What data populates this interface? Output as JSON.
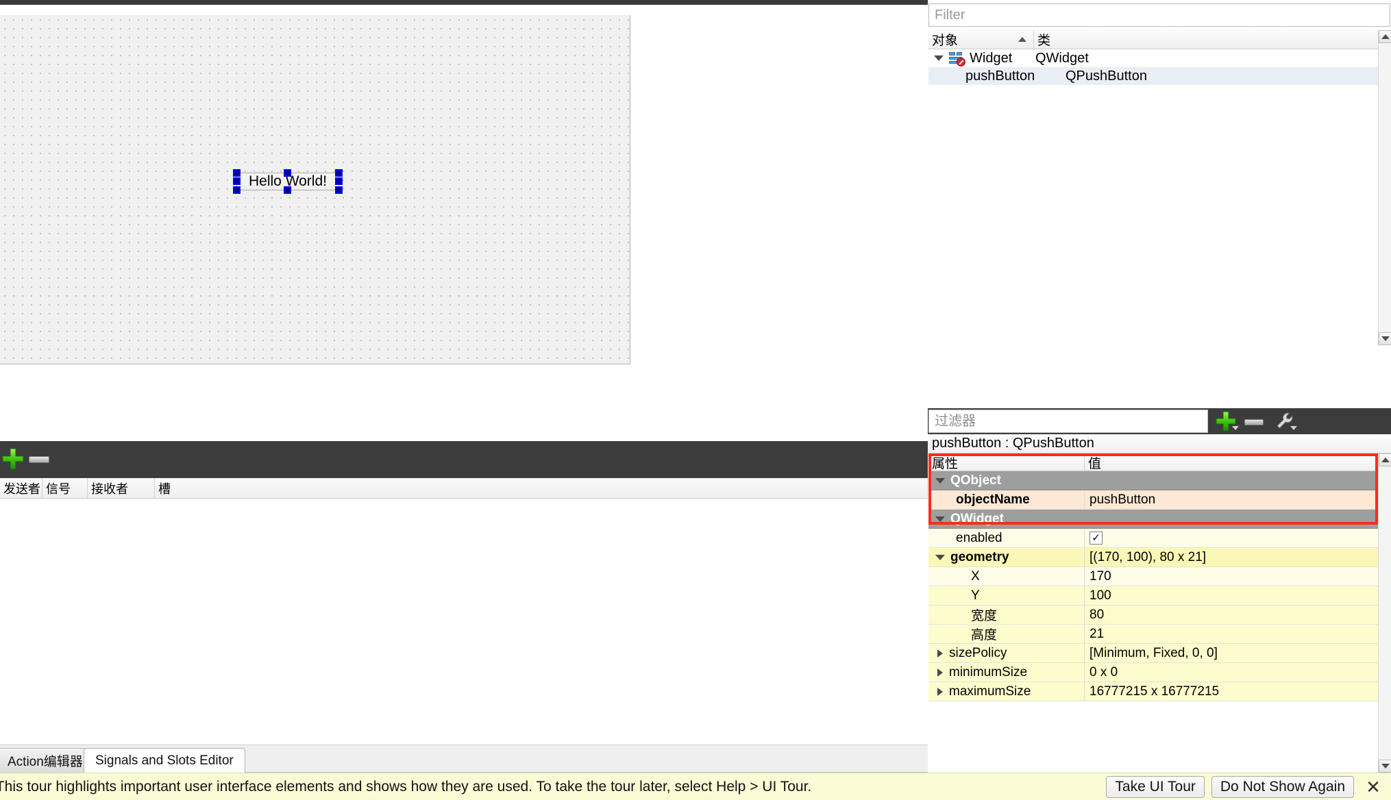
{
  "canvas": {
    "widget_label": "Hello World!"
  },
  "signals_slots": {
    "columns": [
      "发送者",
      "信号",
      "接收者",
      "槽"
    ],
    "add_icon": "plus-icon",
    "remove_icon": "minus-icon",
    "rows": []
  },
  "bottom_tabs": [
    {
      "label": "Action编辑器",
      "active": false
    },
    {
      "label": "Signals and Slots Editor",
      "active": true
    }
  ],
  "object_inspector": {
    "filter_placeholder": "Filter",
    "filter_value": "",
    "columns": [
      "对象",
      "类"
    ],
    "sort_indicator": "ascending",
    "rows": [
      {
        "name": "Widget",
        "class": "QWidget",
        "depth": 0,
        "expanded": true,
        "icon": "widget-no-layout-icon",
        "selected": false
      },
      {
        "name": "pushButton",
        "class": "QPushButton",
        "depth": 1,
        "expanded": false,
        "icon": "",
        "selected": true
      }
    ]
  },
  "property_editor": {
    "filter_placeholder": "过滤器",
    "filter_value": "",
    "add_icon": "plus-icon",
    "remove_icon": "minus-icon",
    "config_icon": "wrench-icon",
    "object_title": "pushButton : QPushButton",
    "columns": [
      "属性",
      "值"
    ],
    "highlight_color": "#ff2a1f",
    "rows": [
      {
        "key": "QObject",
        "value": "",
        "type": "group",
        "indent": 0,
        "expander": "down"
      },
      {
        "key": "objectName",
        "value": "pushButton",
        "type": "obj",
        "indent": 1,
        "expander": "none"
      },
      {
        "key": "QWidget",
        "value": "",
        "type": "group",
        "indent": 0,
        "expander": "down"
      },
      {
        "key": "enabled",
        "value": "",
        "type": "white",
        "indent": 1,
        "expander": "none",
        "control": "checkbox",
        "checked": true
      },
      {
        "key": "geometry",
        "value": "[(170, 100), 80 x 21]",
        "type": "pale2",
        "indent": 0,
        "expander": "down",
        "bold": true
      },
      {
        "key": "X",
        "value": "170",
        "type": "white",
        "indent": 2,
        "expander": "none"
      },
      {
        "key": "Y",
        "value": "100",
        "type": "pale",
        "indent": 2,
        "expander": "none"
      },
      {
        "key": "宽度",
        "value": "80",
        "type": "pale",
        "indent": 2,
        "expander": "none"
      },
      {
        "key": "高度",
        "value": "21",
        "type": "pale",
        "indent": 2,
        "expander": "none"
      },
      {
        "key": "sizePolicy",
        "value": "[Minimum, Fixed, 0, 0]",
        "type": "pale",
        "indent": 0,
        "expander": "right"
      },
      {
        "key": "minimumSize",
        "value": "0 x 0",
        "type": "pale",
        "indent": 0,
        "expander": "right"
      },
      {
        "key": "maximumSize",
        "value": "16777215 x 16777215",
        "type": "pale",
        "indent": 0,
        "expander": "right"
      }
    ]
  },
  "notification": {
    "message": "ur? This tour highlights important user interface elements and shows how they are used. To take the tour later, select Help > UI Tour.",
    "take_tour_label": "Take UI Tour",
    "dismiss_label": "Do Not Show Again",
    "close_icon": "close-icon"
  }
}
